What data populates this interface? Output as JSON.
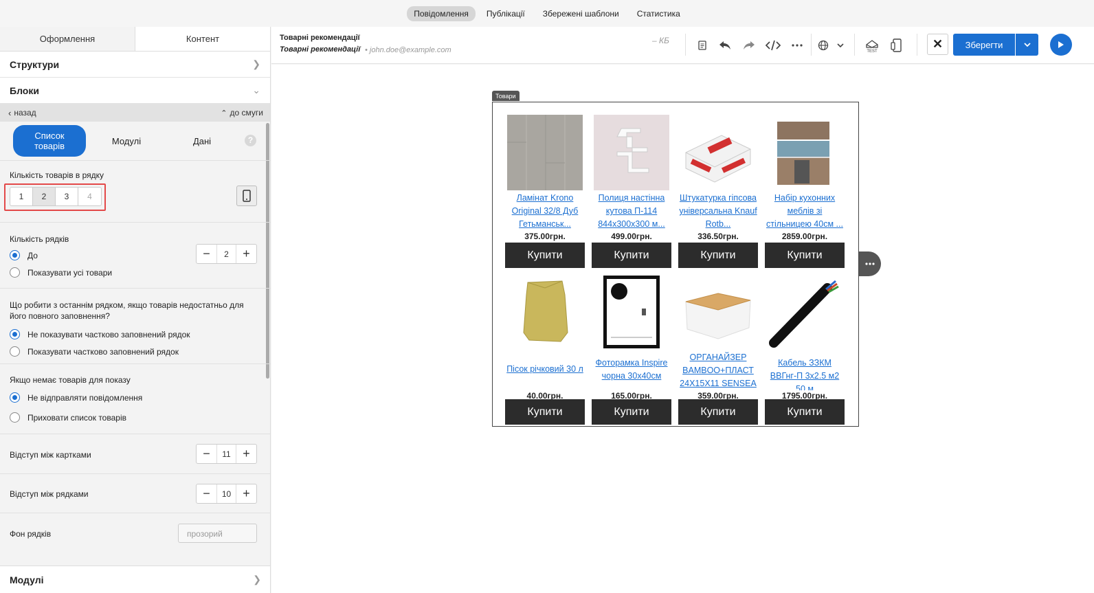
{
  "topnav": {
    "tabs": [
      "Повідомлення",
      "Публікації",
      "Збережені шаблони",
      "Статистика"
    ]
  },
  "left": {
    "tabs": [
      "Оформлення",
      "Контент"
    ],
    "structures": "Структури",
    "blocks": "Блоки",
    "back": "назад",
    "to_strip": "до смуги",
    "subtabs": [
      "Список товарів",
      "Модулі",
      "Дані"
    ],
    "help": "?",
    "per_row_label": "Кількість товарів в рядку",
    "per_row_options": [
      "1",
      "2",
      "3",
      "4"
    ],
    "rows_label": "Кількість рядків",
    "rows_opt1": "До",
    "rows_opt2": "Показувати усі товари",
    "rows_value": "2",
    "lastrow_label": "Що робити з останнім рядком, якщо товарів недостатньо для його повного заповнення?",
    "lastrow_opt1": "Не показувати частково заповнений рядок",
    "lastrow_opt2": "Показувати частково заповнений рядок",
    "empty_label": "Якщо немає товарів для показу",
    "empty_opt1": "Не відправляти повідомлення",
    "empty_opt2": "Приховати список товарів",
    "card_gap_label": "Відступ між картками",
    "card_gap_value": "11",
    "row_gap_label": "Відступ між рядками",
    "row_gap_value": "10",
    "bg_label": "Фон рядків",
    "bg_placeholder": "прозорий",
    "modules": "Модулі"
  },
  "toolbar": {
    "title": "Товарні рекомендації",
    "subtitle": "Товарні рекомендації",
    "email": "• john.doe@example.com",
    "size": "– КБ",
    "save": "Зберегти"
  },
  "canvas": {
    "tag": "Товари",
    "buy": "Купити",
    "products": [
      {
        "name": "Ламінат Krono Original 32/8 Дуб Гетьманськ...",
        "price": "375.00грн."
      },
      {
        "name": "Полиця настінна кутова П-114 844x300x300 м...",
        "price": "499.00грн."
      },
      {
        "name": "Штукатурка гіпсова універсальна Knauf Rotb...",
        "price": "336.50грн."
      },
      {
        "name": "Набір кухонних меблів зі стільницею 40см ...",
        "price": "2859.00грн."
      },
      {
        "name": "Пісок річковий 30 л",
        "price": "40.00грн."
      },
      {
        "name": "Фоторамка Inspire чорна 30х40см",
        "price": "165.00грн."
      },
      {
        "name": "ОРГАНАЙЗЕР BAMBOO+ПЛАСТ 24X15X11 SENSEA",
        "price": "359.00грн."
      },
      {
        "name": "Кабель ЗЗКМ ВВГнг-П 3х2.5 м2 50 м",
        "price": "1795.00грн."
      }
    ]
  },
  "colors": {
    "accent": "#1b6fd1",
    "highlight": "#e34848",
    "buy_button": "#2c2c2c"
  }
}
